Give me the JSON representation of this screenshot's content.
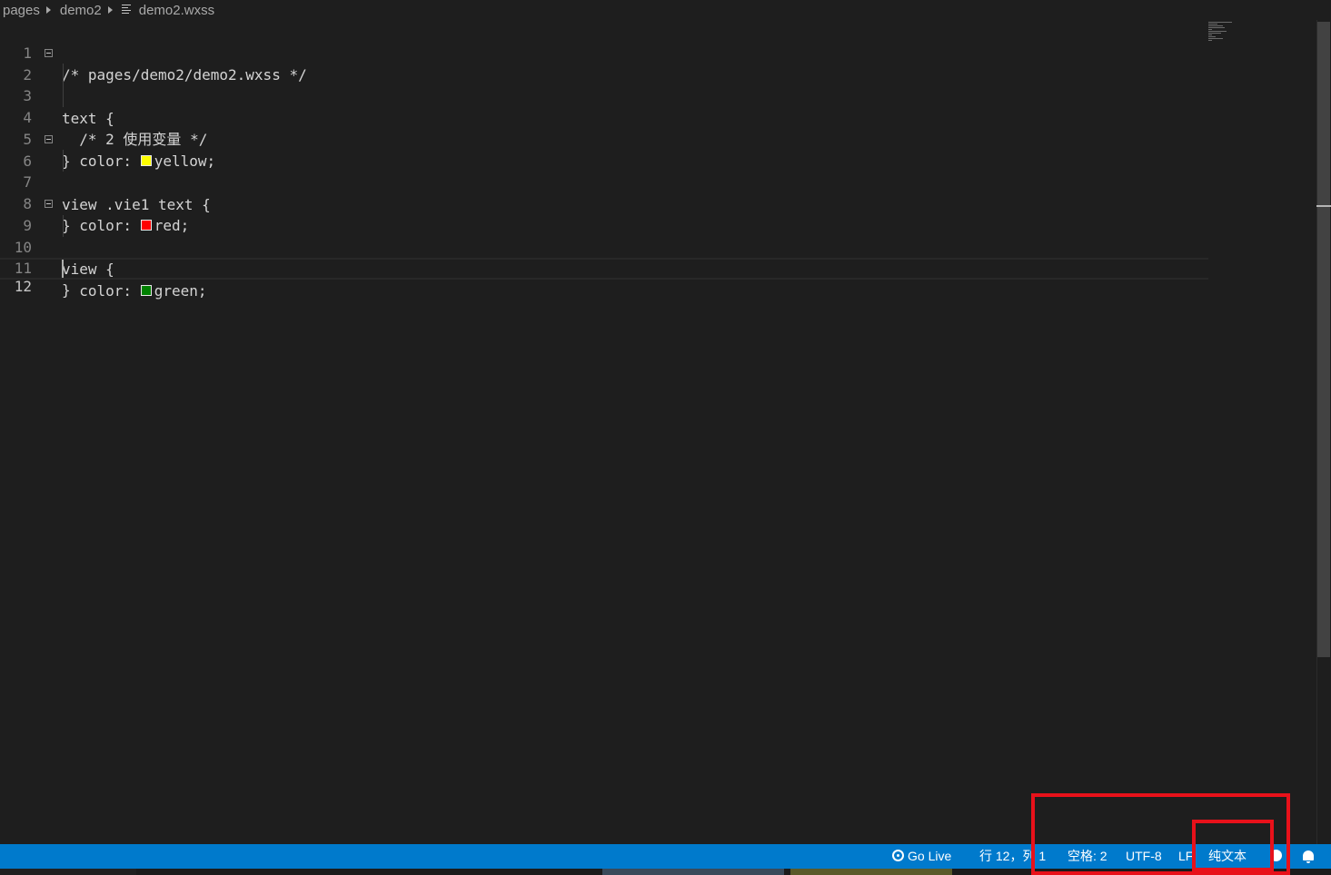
{
  "breadcrumb": {
    "items": [
      "pages",
      "demo2",
      "demo2.wxss"
    ]
  },
  "editor": {
    "lines": [
      {
        "number": "1",
        "text": "/* pages/demo2/demo2.wxss */"
      },
      {
        "number": "2",
        "text": "text {"
      },
      {
        "number": "3",
        "text": "  /* 2 使用变量 */"
      },
      {
        "number": "4",
        "prefix": "  color: ",
        "value": "yellow;"
      },
      {
        "number": "5",
        "text": "}"
      },
      {
        "number": "6",
        "text": "view .vie1 text {"
      },
      {
        "number": "7",
        "prefix": "  color: ",
        "value": "red;"
      },
      {
        "number": "8",
        "text": "}"
      },
      {
        "number": "9",
        "text": "view {"
      },
      {
        "number": "10",
        "prefix": "  color: ",
        "value": "green;"
      },
      {
        "number": "11",
        "text": "}"
      },
      {
        "number": "12",
        "text": ""
      }
    ],
    "swatch_colors": {
      "yellow": "#ffff00",
      "red": "#ff0000",
      "green": "#008000"
    }
  },
  "statusbar": {
    "go_live": "Go Live",
    "position": "行 12，列 1",
    "spaces": "空格: 2",
    "encoding": "UTF-8",
    "eol": "LF",
    "language": "纯文本",
    "icons": [
      "broadcast-icon",
      "smiley-icon",
      "bell-icon"
    ]
  },
  "colors": {
    "statusbar_bg": "#007acc",
    "editor_bg": "#1e1e1e",
    "annotation_red": "#e8111a"
  }
}
